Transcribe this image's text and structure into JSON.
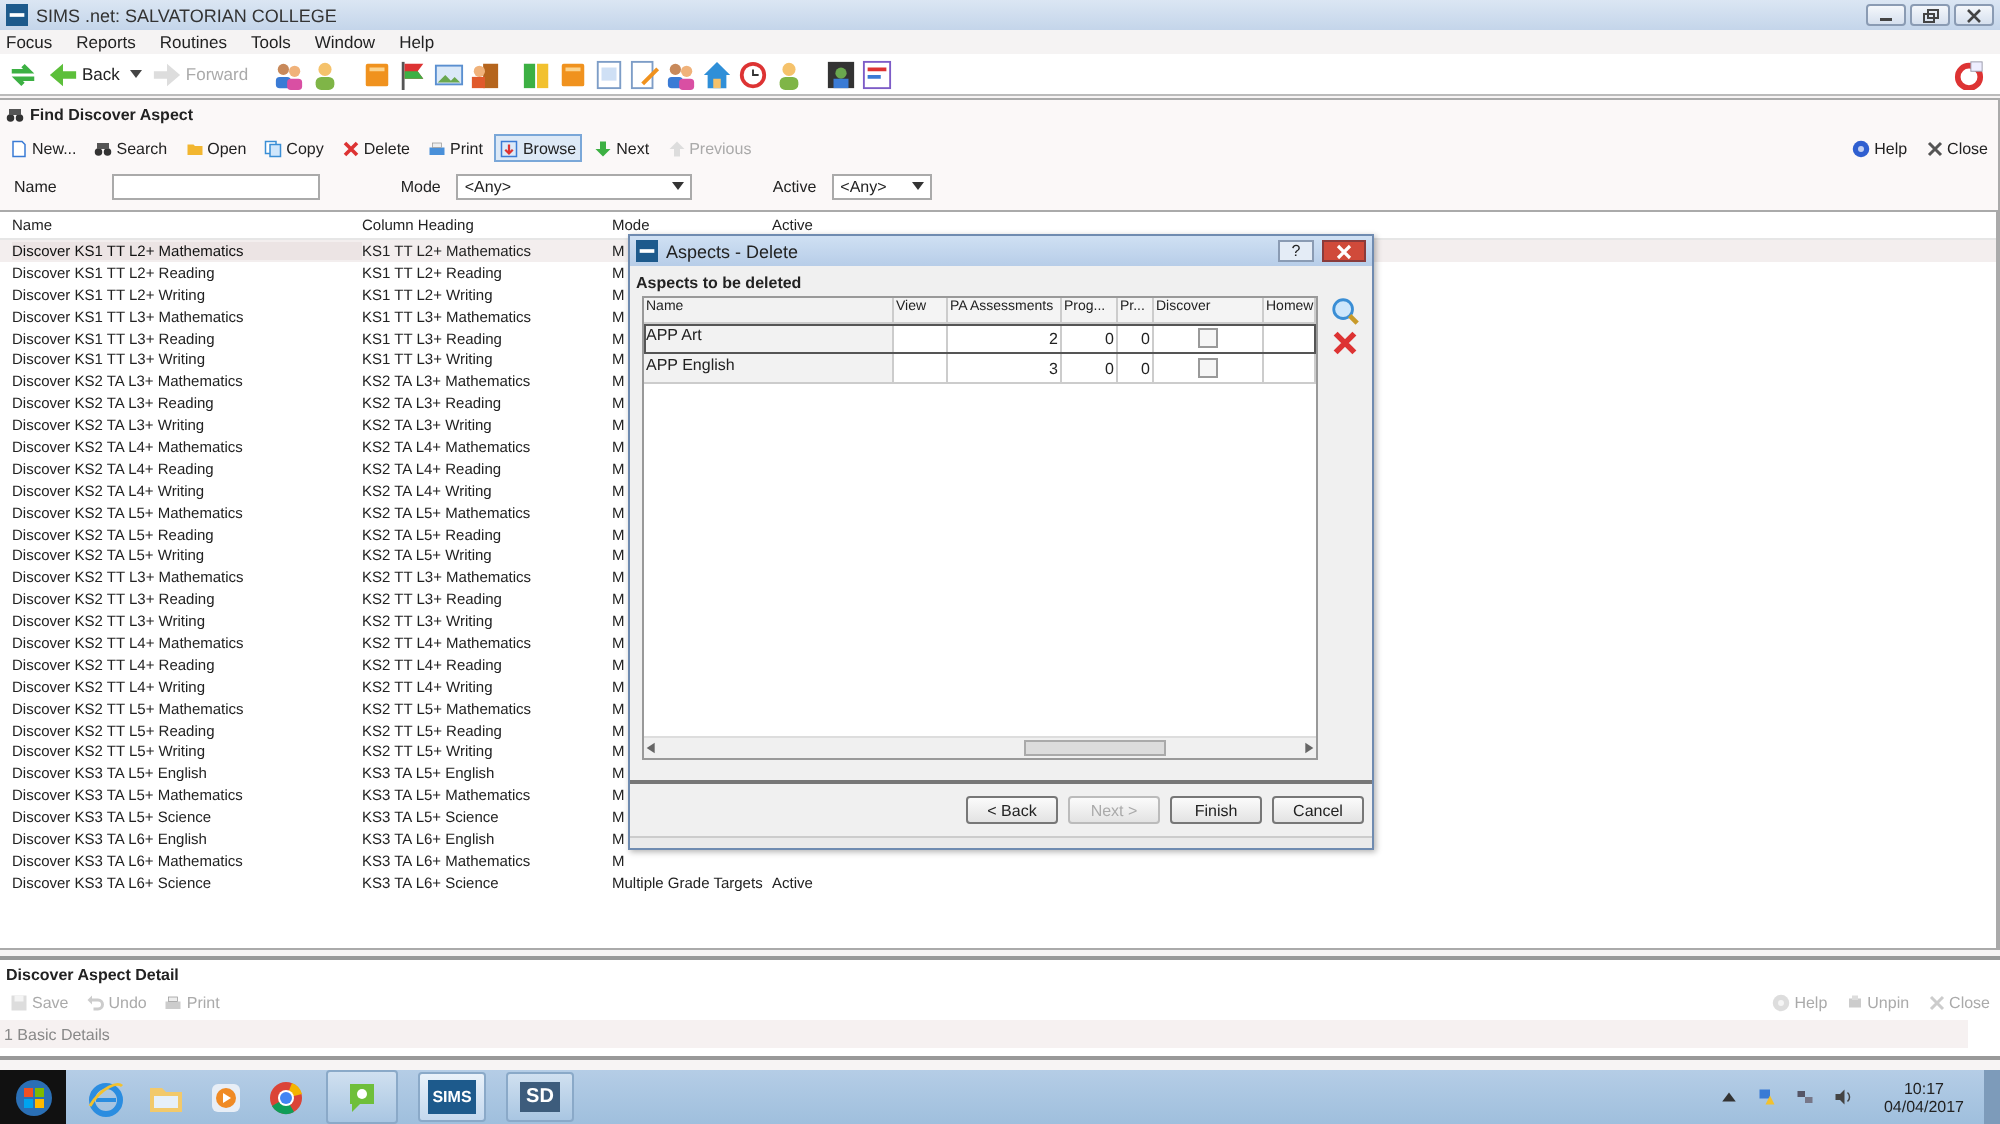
{
  "window": {
    "title": "SIMS .net: SALVATORIAN COLLEGE"
  },
  "menu": [
    "Focus",
    "Reports",
    "Routines",
    "Tools",
    "Window",
    "Help"
  ],
  "nav": {
    "back": "Back",
    "forward": "Forward",
    "forward_disabled": true
  },
  "find_panel": {
    "title": "Find Discover Aspect",
    "toolbar": [
      {
        "label": "New...",
        "disabled": false,
        "selected": false
      },
      {
        "label": "Search",
        "disabled": false,
        "selected": false
      },
      {
        "label": "Open",
        "disabled": false,
        "selected": false
      },
      {
        "label": "Copy",
        "disabled": false,
        "selected": false
      },
      {
        "label": "Delete",
        "disabled": false,
        "selected": false
      },
      {
        "label": "Print",
        "disabled": false,
        "selected": false
      },
      {
        "label": "Browse",
        "disabled": false,
        "selected": true
      },
      {
        "label": "Next",
        "disabled": false,
        "selected": false
      },
      {
        "label": "Previous",
        "disabled": true,
        "selected": false
      }
    ],
    "right_buttons": [
      {
        "label": "Help",
        "disabled": false
      },
      {
        "label": "Close",
        "disabled": false
      }
    ],
    "filters": [
      {
        "kind": "text",
        "label": "Name"
      },
      {
        "kind": "select",
        "label": "Mode",
        "value": "<Any>"
      },
      {
        "kind": "select",
        "label": "Active",
        "value": "<Any>"
      }
    ],
    "table": {
      "columns": [
        "Name",
        "Column Heading",
        "Mode",
        "Active"
      ],
      "rows": [
        {
          "name": "Discover KS1 TT L2+ Mathematics",
          "heading": "KS1 TT L2+ Mathematics",
          "mode": "M",
          "selected": true
        },
        {
          "name": "Discover KS1 TT L2+ Reading",
          "heading": "KS1 TT L2+ Reading",
          "mode": "M",
          "selected": false
        },
        {
          "name": "Discover KS1 TT L2+ Writing",
          "heading": "KS1 TT L2+ Writing",
          "mode": "M",
          "selected": false
        },
        {
          "name": "Discover KS1 TT L3+ Mathematics",
          "heading": "KS1 TT L3+ Mathematics",
          "mode": "M",
          "selected": false
        },
        {
          "name": "Discover KS1 TT L3+ Reading",
          "heading": "KS1 TT L3+ Reading",
          "mode": "M",
          "selected": false
        },
        {
          "name": "Discover KS1 TT L3+ Writing",
          "heading": "KS1 TT L3+ Writing",
          "mode": "M",
          "selected": false
        },
        {
          "name": "Discover KS2 TA L3+ Mathematics",
          "heading": "KS2 TA L3+ Mathematics",
          "mode": "M",
          "selected": false
        },
        {
          "name": "Discover KS2 TA L3+ Reading",
          "heading": "KS2 TA L3+ Reading",
          "mode": "M",
          "selected": false
        },
        {
          "name": "Discover KS2 TA L3+ Writing",
          "heading": "KS2 TA L3+ Writing",
          "mode": "M",
          "selected": false
        },
        {
          "name": "Discover KS2 TA L4+ Mathematics",
          "heading": "KS2 TA L4+ Mathematics",
          "mode": "M",
          "selected": false
        },
        {
          "name": "Discover KS2 TA L4+ Reading",
          "heading": "KS2 TA L4+ Reading",
          "mode": "M",
          "selected": false
        },
        {
          "name": "Discover KS2 TA L4+ Writing",
          "heading": "KS2 TA L4+ Writing",
          "mode": "M",
          "selected": false
        },
        {
          "name": "Discover KS2 TA L5+ Mathematics",
          "heading": "KS2 TA L5+ Mathematics",
          "mode": "M",
          "selected": false
        },
        {
          "name": "Discover KS2 TA L5+ Reading",
          "heading": "KS2 TA L5+ Reading",
          "mode": "M",
          "selected": false
        },
        {
          "name": "Discover KS2 TA L5+ Writing",
          "heading": "KS2 TA L5+ Writing",
          "mode": "M",
          "selected": false
        },
        {
          "name": "Discover KS2 TT L3+ Mathematics",
          "heading": "KS2 TT L3+ Mathematics",
          "mode": "M",
          "selected": false
        },
        {
          "name": "Discover KS2 TT L3+ Reading",
          "heading": "KS2 TT L3+ Reading",
          "mode": "M",
          "selected": false
        },
        {
          "name": "Discover KS2 TT L3+ Writing",
          "heading": "KS2 TT L3+ Writing",
          "mode": "M",
          "selected": false
        },
        {
          "name": "Discover KS2 TT L4+ Mathematics",
          "heading": "KS2 TT L4+ Mathematics",
          "mode": "M",
          "selected": false
        },
        {
          "name": "Discover KS2 TT L4+ Reading",
          "heading": "KS2 TT L4+ Reading",
          "mode": "M",
          "selected": false
        },
        {
          "name": "Discover KS2 TT L4+ Writing",
          "heading": "KS2 TT L4+ Writing",
          "mode": "M",
          "selected": false
        },
        {
          "name": "Discover KS2 TT L5+ Mathematics",
          "heading": "KS2 TT L5+ Mathematics",
          "mode": "M",
          "selected": false
        },
        {
          "name": "Discover KS2 TT L5+ Reading",
          "heading": "KS2 TT L5+ Reading",
          "mode": "M",
          "selected": false
        },
        {
          "name": "Discover KS2 TT L5+ Writing",
          "heading": "KS2 TT L5+ Writing",
          "mode": "M",
          "selected": false
        },
        {
          "name": "Discover KS3 TA L5+ English",
          "heading": "KS3 TA L5+ English",
          "mode": "M",
          "selected": false
        },
        {
          "name": "Discover KS3 TA L5+ Mathematics",
          "heading": "KS3 TA L5+ Mathematics",
          "mode": "M",
          "selected": false
        },
        {
          "name": "Discover KS3 TA L5+ Science",
          "heading": "KS3 TA L5+ Science",
          "mode": "M",
          "selected": false
        },
        {
          "name": "Discover KS3 TA L6+ English",
          "heading": "KS3 TA L6+ English",
          "mode": "M",
          "selected": false
        },
        {
          "name": "Discover KS3 TA L6+ Mathematics",
          "heading": "KS3 TA L6+ Mathematics",
          "mode": "M",
          "selected": false
        },
        {
          "name": "Discover KS3 TA L6+ Science",
          "heading": "KS3 TA L6+ Science",
          "mode": "Multiple Grade Targets",
          "active": "Active",
          "selected": false
        }
      ]
    }
  },
  "detail_panel": {
    "title": "Discover Aspect Detail",
    "toolbar": [
      {
        "label": "Save",
        "disabled": true
      },
      {
        "label": "Undo",
        "disabled": true
      },
      {
        "label": "Print",
        "disabled": true
      }
    ],
    "right_buttons": [
      {
        "label": "Help",
        "disabled": true
      },
      {
        "label": "Unpin",
        "disabled": true
      },
      {
        "label": "Close",
        "disabled": true
      }
    ],
    "section": "1 Basic Details"
  },
  "dialog": {
    "title": "Aspects - Delete",
    "help_glyph": "?",
    "heading": "Aspects to be deleted",
    "columns": [
      "Name",
      "View",
      "PA Assessments",
      "Prog...",
      "Pr...",
      "Discover",
      "Homew"
    ],
    "rows": [
      {
        "name": "APP Art",
        "pa_assessments": "2",
        "prog": "0",
        "pr": "0",
        "discover": false,
        "selected": true
      },
      {
        "name": "APP English",
        "pa_assessments": "3",
        "prog": "0",
        "pr": "0",
        "discover": false,
        "selected": false
      }
    ],
    "buttons": [
      {
        "label": "< Back",
        "disabled": false
      },
      {
        "label": "Next >",
        "disabled": true
      },
      {
        "label": "Finish",
        "disabled": false
      },
      {
        "label": "Cancel",
        "disabled": false
      }
    ]
  },
  "taskbar": {
    "apps": [
      {
        "label": "SIMS",
        "active": true
      },
      {
        "label": "SD",
        "active": false
      }
    ],
    "time": "10:17",
    "date": "04/04/2017"
  }
}
